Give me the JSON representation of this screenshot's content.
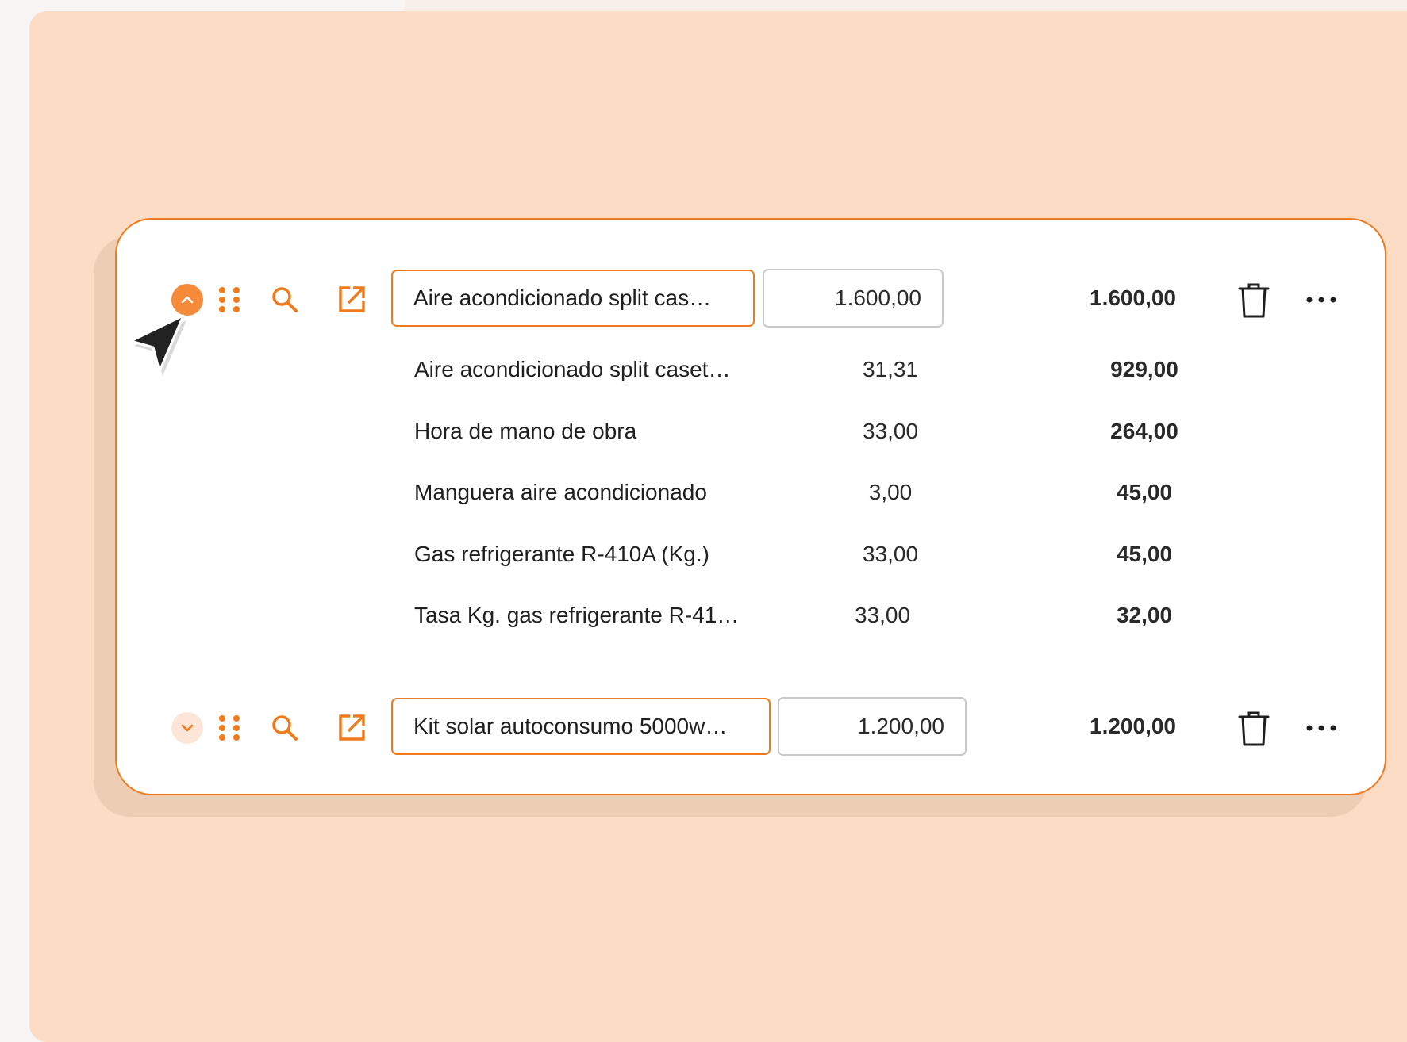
{
  "colors": {
    "accent": "#f07a1f",
    "panel_background": "#fcdcc4",
    "card_background": "#ffffff",
    "field_border": "#c9c9c9"
  },
  "items": [
    {
      "expanded": true,
      "toggle_icon": "chevron-up-icon",
      "name": "Aire acondicionado split cas…",
      "quantity": "1.600,00",
      "total": "1.600,00",
      "components": [
        {
          "name": "Aire acondicionado split caset…",
          "quantity": "31,31",
          "total": "929,00"
        },
        {
          "name": "Hora de mano de obra",
          "quantity": "33,00",
          "total": "264,00"
        },
        {
          "name": "Manguera aire acondicionado",
          "quantity": "3,00",
          "total": "45,00"
        },
        {
          "name": "Gas refrigerante R-410A (Kg.)",
          "quantity": "33,00",
          "total": "45,00"
        },
        {
          "name": "Tasa Kg. gas refrigerante R-41…",
          "quantity": "33,00",
          "total": "32,00"
        }
      ]
    },
    {
      "expanded": false,
      "toggle_icon": "chevron-down-icon",
      "name": "Kit solar autoconsumo 5000w…",
      "quantity": "1.200,00",
      "total": "1.200,00",
      "components": []
    }
  ],
  "icons": {
    "drag": "drag-handle-icon",
    "search": "search-icon",
    "open": "open-external-icon",
    "delete": "trash-icon",
    "more": "more-horizontal-icon",
    "cursor": "mouse-cursor-icon"
  }
}
